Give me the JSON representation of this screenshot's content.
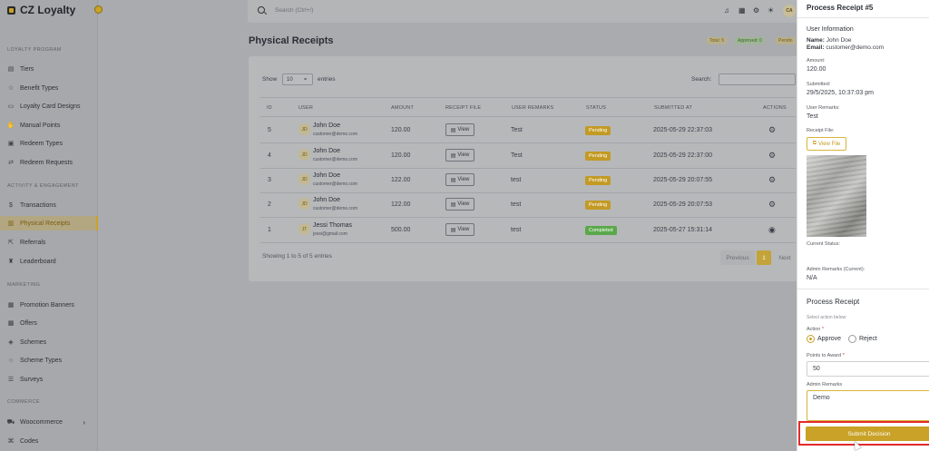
{
  "app": {
    "name": "CZ Loyalty"
  },
  "sidebar": {
    "sections": [
      {
        "title": "LOYALTY PROGRAM"
      },
      {
        "title": "ACTIVITY & ENGAGEMENT"
      },
      {
        "title": "MARKETING"
      },
      {
        "title": "COMMERCE"
      }
    ],
    "items": [
      {
        "label": "Tiers",
        "icon": "tiers-icon"
      },
      {
        "label": "Benefit Types",
        "icon": "star-icon"
      },
      {
        "label": "Loyalty Card Designs",
        "icon": "card-icon"
      },
      {
        "label": "Manual Points",
        "icon": "hand-points-icon"
      },
      {
        "label": "Redeem Types",
        "icon": "gift-icon"
      },
      {
        "label": "Redeem Requests",
        "icon": "exchange-icon"
      },
      {
        "label": "Transactions",
        "icon": "dollar-icon"
      },
      {
        "label": "Physical Receipts",
        "icon": "receipt-icon"
      },
      {
        "label": "Referrals",
        "icon": "share-icon"
      },
      {
        "label": "Leaderboard",
        "icon": "trophy-icon"
      },
      {
        "label": "Promotion Banners",
        "icon": "banner-icon"
      },
      {
        "label": "Offers",
        "icon": "offer-icon"
      },
      {
        "label": "Schemes",
        "icon": "layers-icon"
      },
      {
        "label": "Scheme Types",
        "icon": "circle-icon"
      },
      {
        "label": "Surveys",
        "icon": "list-icon"
      },
      {
        "label": "Woocommerce",
        "icon": "cart-icon"
      },
      {
        "label": "Codes",
        "icon": "code-icon"
      }
    ],
    "active": "Physical Receipts"
  },
  "topbar": {
    "search_placeholder": "Search (Ctrl+/)",
    "avatar_initials": "CA"
  },
  "page": {
    "title": "Physical Receipts",
    "badges": [
      {
        "label": "Total: 5",
        "color": "#c9a227"
      },
      {
        "label": "Approved: 0",
        "color": "#5aa84a"
      },
      {
        "label": "Pendin",
        "color": "#c9a227"
      }
    ]
  },
  "table": {
    "show_label": "Show",
    "page_size": "10",
    "entries_label": "entries",
    "search_label": "Search:",
    "columns": [
      "ID",
      "USER",
      "AMOUNT",
      "RECEIPT FILE",
      "USER REMARKS",
      "STATUS",
      "SUBMITTED AT",
      "ACTIONS"
    ],
    "view_label": "View",
    "rows": [
      {
        "id": "5",
        "initials": "JD",
        "name": "John Doe",
        "email": "customer@demo.com",
        "amount": "120.00",
        "remarks": "Test",
        "status": "Pending",
        "submitted": "2025-05-29 22:37:03",
        "action_icon": "gear-icon"
      },
      {
        "id": "4",
        "initials": "JD",
        "name": "John Doe",
        "email": "customer@demo.com",
        "amount": "120.00",
        "remarks": "Test",
        "status": "Pending",
        "submitted": "2025-05-29 22:37:00",
        "action_icon": "gear-icon"
      },
      {
        "id": "3",
        "initials": "JD",
        "name": "John Doe",
        "email": "customer@demo.com",
        "amount": "122.00",
        "remarks": "test",
        "status": "Pending",
        "submitted": "2025-05-29 20:07:55",
        "action_icon": "gear-icon"
      },
      {
        "id": "2",
        "initials": "JD",
        "name": "John Doe",
        "email": "customer@demo.com",
        "amount": "122.00",
        "remarks": "test",
        "status": "Pending",
        "submitted": "2025-05-29 20:07:53",
        "action_icon": "gear-icon"
      },
      {
        "id": "1",
        "initials": "JT",
        "name": "Jessi Thomas",
        "email": "jessi@gmail.com",
        "amount": "500.00",
        "remarks": "test",
        "status": "Completed",
        "submitted": "2025-05-27 15:31:14",
        "action_icon": "eye-icon"
      }
    ],
    "footer_text": "Showing 1 to 5 of 5 entries",
    "pagination": {
      "previous": "Previous",
      "current": "1",
      "next": "Next"
    }
  },
  "panel": {
    "title": "Process Receipt #5",
    "user_info_heading": "User Information",
    "name_label": "Name:",
    "name_value": "John Doe",
    "email_label": "Email:",
    "email_value": "customer@demo.com",
    "amount_label": "Amount:",
    "amount_value": "120.00",
    "submitted_label": "Submitted:",
    "submitted_value": "29/5/2025, 10:37:03 pm",
    "remarks_label": "User Remarks:",
    "remarks_value": "Test",
    "receipt_file_label": "Receipt File:",
    "view_file_label": "View File",
    "current_status_label": "Current Status:",
    "admin_remarks_current_label": "Admin Remarks (Current):",
    "admin_remarks_current_value": "N/A",
    "process_heading": "Process Receipt",
    "select_action_hint": "Select action below:",
    "action_label": "Action",
    "required_mark": "*",
    "approve_label": "Approve",
    "reject_label": "Reject",
    "selected_action": "Approve",
    "points_label": "Points to Award",
    "points_value": "50",
    "admin_remarks_label": "Admin Remarks",
    "admin_remarks_value": "Demo",
    "submit_label": "Submit Decision"
  }
}
